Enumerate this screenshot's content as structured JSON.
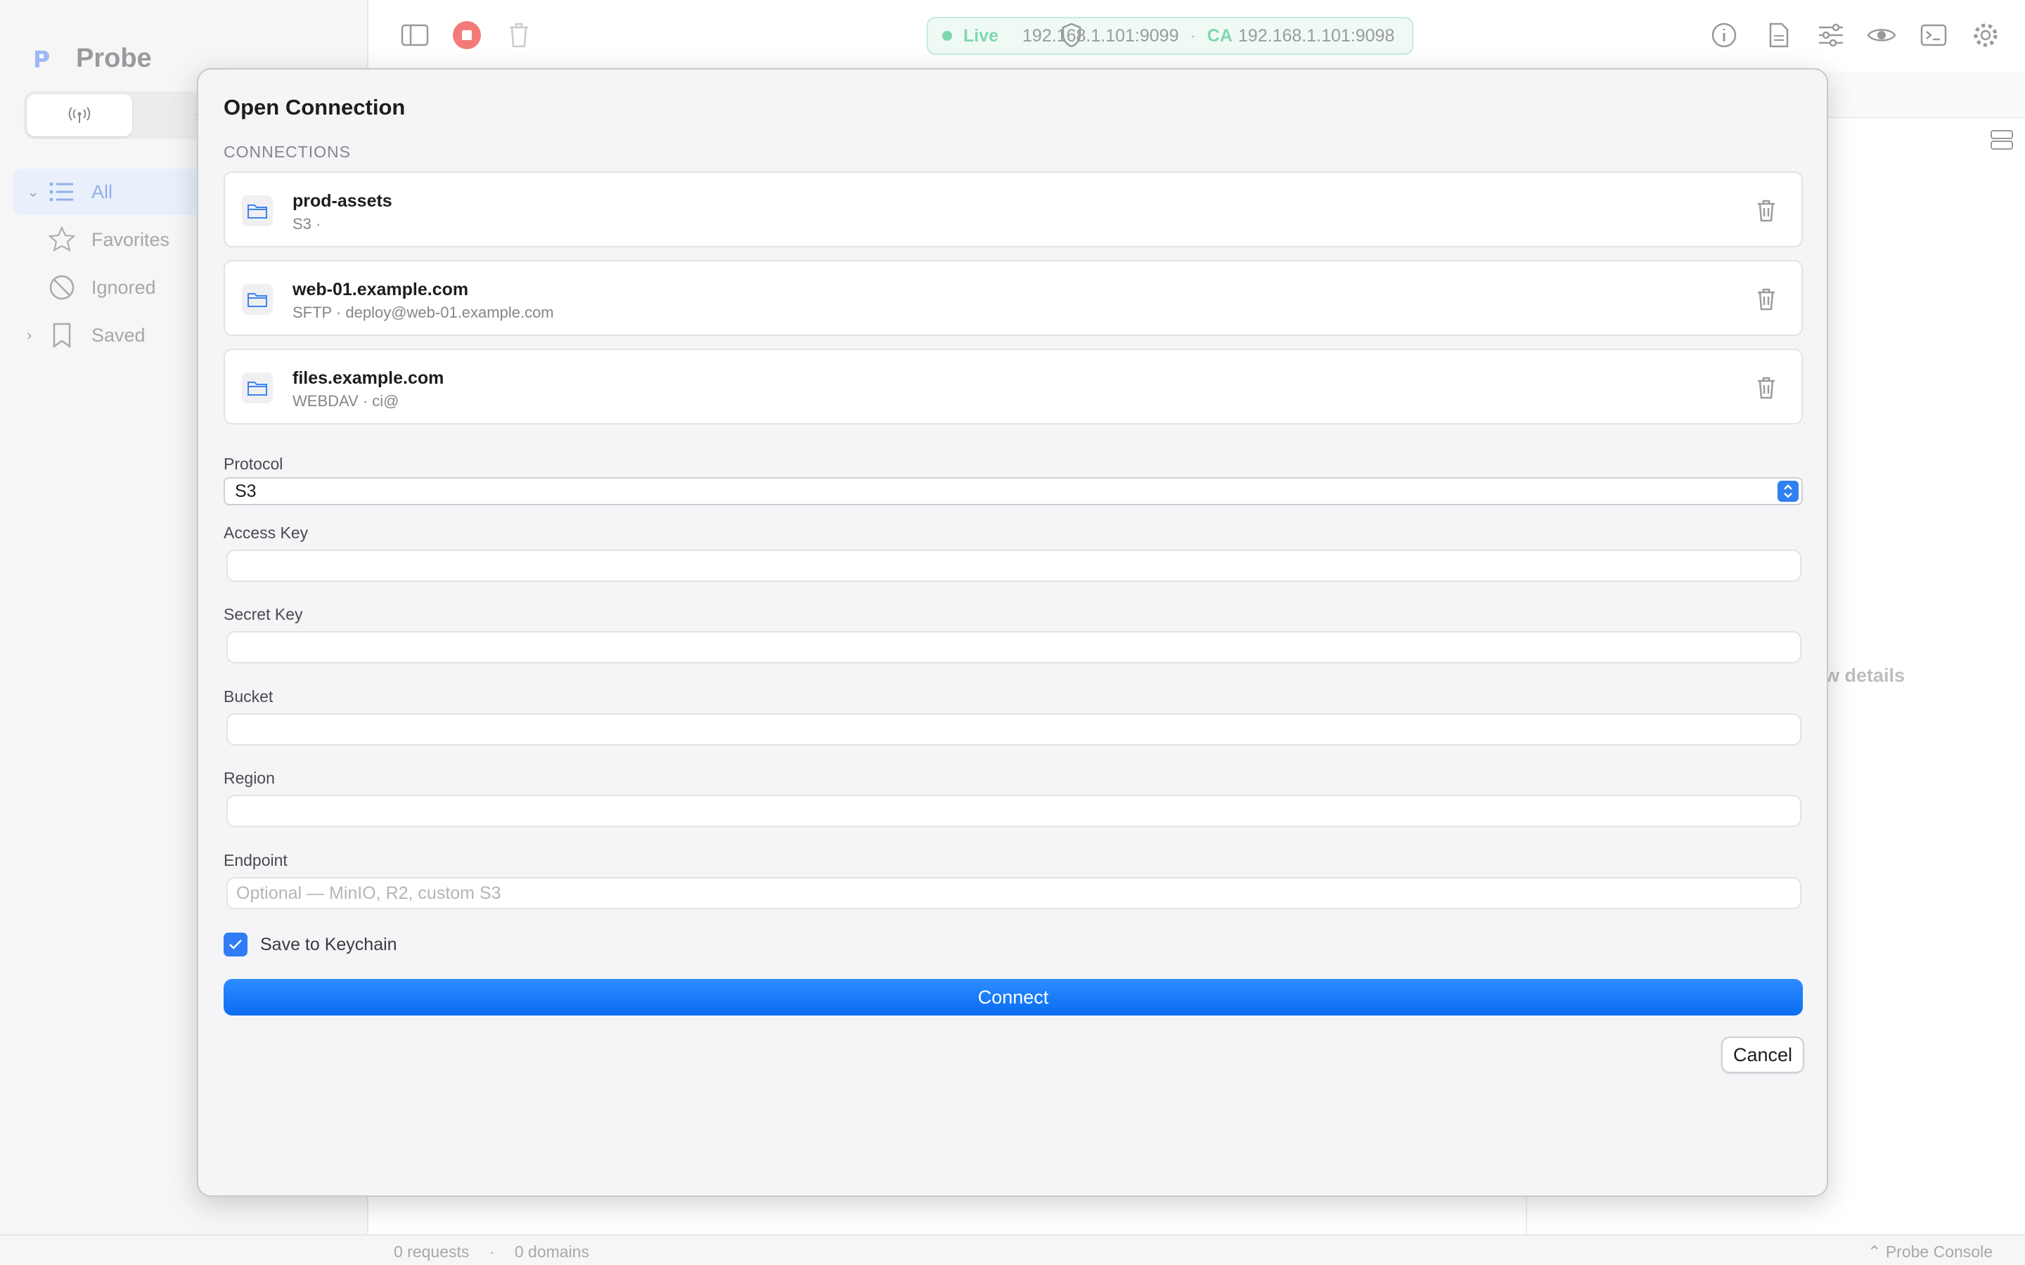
{
  "app": {
    "name": "Probe"
  },
  "sidebar": {
    "items": [
      {
        "label": "All",
        "icon": "list-icon",
        "active": true
      },
      {
        "label": "Favorites",
        "icon": "star-icon"
      },
      {
        "label": "Ignored",
        "icon": "prohibited-icon"
      },
      {
        "label": "Saved",
        "icon": "bookmark-icon"
      }
    ]
  },
  "toolbar": {
    "live_label": "Live",
    "address": "192.168.1.101:9099",
    "ca_label": "CA",
    "ca_address": "192.168.1.101:9098"
  },
  "detail": {
    "hint": "ew details"
  },
  "status": {
    "requests": "0 requests",
    "separator": "·",
    "domains": "0 domains",
    "console": "Probe Console"
  },
  "dialog": {
    "title": "Open Connection",
    "section_label": "CONNECTIONS",
    "connections": [
      {
        "name": "prod-assets",
        "detail": "S3 ·"
      },
      {
        "name": "web-01.example.com",
        "detail": "SFTP · deploy@web-01.example.com"
      },
      {
        "name": "files.example.com",
        "detail": "WEBDAV · ci@"
      }
    ],
    "protocol_label": "Protocol",
    "protocol_value": "S3",
    "fields": [
      {
        "label": "Access Key",
        "value": "",
        "placeholder": ""
      },
      {
        "label": "Secret Key",
        "value": "",
        "placeholder": ""
      },
      {
        "label": "Bucket",
        "value": "",
        "placeholder": ""
      },
      {
        "label": "Region",
        "value": "",
        "placeholder": ""
      },
      {
        "label": "Endpoint",
        "value": "",
        "placeholder": "Optional — MinIO, R2, custom S3"
      }
    ],
    "save_keychain_label": "Save to Keychain",
    "save_keychain_checked": true,
    "connect_label": "Connect",
    "cancel_label": "Cancel"
  },
  "colors": {
    "accent": "#0a6cf2",
    "live": "#7fd6b0",
    "stop": "#f47a7a"
  }
}
